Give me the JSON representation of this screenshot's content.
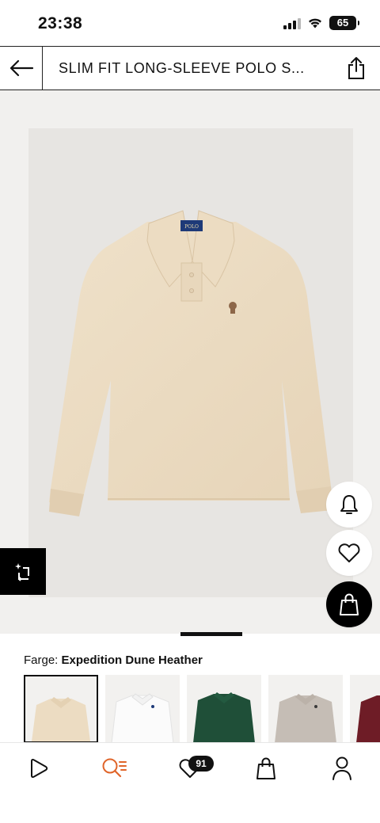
{
  "status_bar": {
    "time": "23:38",
    "battery": "65"
  },
  "header": {
    "title": "SLIM FIT LONG-SLEEVE POLO S...",
    "back_icon": "arrow-left-icon",
    "share_icon": "share-icon"
  },
  "product": {
    "image_alt": "Slim Fit Long-Sleeve Polo Shirt in beige heather",
    "logo_label": "POLO",
    "shirt_color": "#ecdcc2"
  },
  "actions": {
    "notify_icon": "bell-icon",
    "wishlist_icon": "heart-icon",
    "add_to_bag_icon": "shopping-bag-icon",
    "compare_icon": "compare-icon"
  },
  "color": {
    "label": "Farge:",
    "value": "Expedition Dune Heather"
  },
  "swatches": [
    {
      "name": "Expedition Dune Heather",
      "color": "#ecdcc2",
      "selected": true
    },
    {
      "name": "White",
      "color": "#fbfbfb",
      "selected": false
    },
    {
      "name": "Green",
      "color": "#1f4f38",
      "selected": false
    },
    {
      "name": "Grey Heather",
      "color": "#c5bdb5",
      "selected": false
    },
    {
      "name": "Burgundy",
      "color": "#6e1c26",
      "selected": false
    }
  ],
  "bottom_nav": {
    "items": [
      {
        "name": "home",
        "icon": "play-icon"
      },
      {
        "name": "search",
        "icon": "search-icon",
        "color": "#e0652a"
      },
      {
        "name": "wishlist",
        "icon": "heart-icon",
        "badge": "91"
      },
      {
        "name": "bag",
        "icon": "shopping-bag-icon"
      },
      {
        "name": "account",
        "icon": "person-icon"
      }
    ]
  }
}
